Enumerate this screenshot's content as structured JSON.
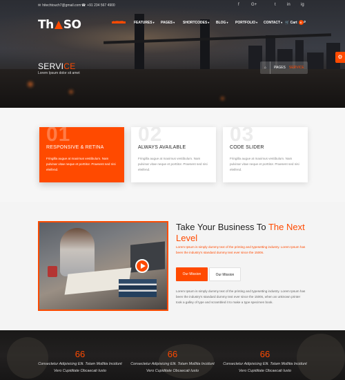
{
  "topbar": {
    "email": "hitechtouch7@gmail.com",
    "phone": "+91 234 567 4900",
    "social": [
      "f",
      "G+",
      "t",
      "in",
      "ig"
    ]
  },
  "logo": {
    "left": "Th",
    "right": "SO"
  },
  "nav": {
    "items": [
      "HOME",
      "FEATURES",
      "PAGES",
      "SHORTCODES",
      "BLOG",
      "PORTFOLIO",
      "CONTACT"
    ],
    "cart_label": "Cart",
    "cart_count": "0"
  },
  "hero": {
    "title_main": "SERVI",
    "title_accent": "CE",
    "subtitle": "Lorem Ipsum dolor sit amet",
    "breadcrumb": {
      "home_icon": "home-icon",
      "parent": "PAGES",
      "current": "SERVICE"
    }
  },
  "features": [
    {
      "num": "01",
      "title": "RESPONSIVE & RETINA",
      "body": "Fringilla augue at maximus vestibulum. Nam pulvinar vitae neque et porttitor. Praesent sed nisi eleifend."
    },
    {
      "num": "02",
      "title": "ALWAYS AVAILABLE",
      "body": "Fringilla augue at maximus vestibulum. Nam pulvinar vitae neque et porttitor. Praesent sed nisi eleifend."
    },
    {
      "num": "03",
      "title": "CODE SLIDER",
      "body": "Fringilla augue at maximus vestibulum. Nam pulvinar vitae neque et porttitor. Praesent sed nisi eleifend."
    }
  ],
  "business": {
    "title_main": "Take Your Business To ",
    "title_accent": "The Next Level",
    "text1": "Lorem Ipsum is simply dummy text of the printing and typesetting industry. Lorem Ipsum has been the industry's standard dummy text ever since the 1500s.",
    "button_primary": "Our Mission",
    "button_secondary": "Our Mission",
    "text2": "Lorem Ipsum is simply dummy text of the printing and typesetting industry. Lorem Ipsum has been the industry's standard dummy text ever since the 1500s, when an unknown printer took a galley of type and scrambled it to make a type specimen book."
  },
  "counters": [
    {
      "value": "66",
      "text": "Consectetur Adipisicing Elit. Totam Mollitia Incidunt Vero Cupiditate Obcaecati Iusto"
    },
    {
      "value": "66",
      "text": "Consectetur Adipisicing Elit. Totam Mollitia Incidunt Vero Cupiditate Obcaecati Iusto"
    },
    {
      "value": "66",
      "text": "Consectetur Adipisicing Elit. Totam Mollitia Incidunt Vero Cupiditate Obcaecati Iusto"
    }
  ],
  "colors": {
    "accent": "#ff4a00",
    "dark": "#1a1918",
    "light_bg": "#f4f4f4"
  }
}
